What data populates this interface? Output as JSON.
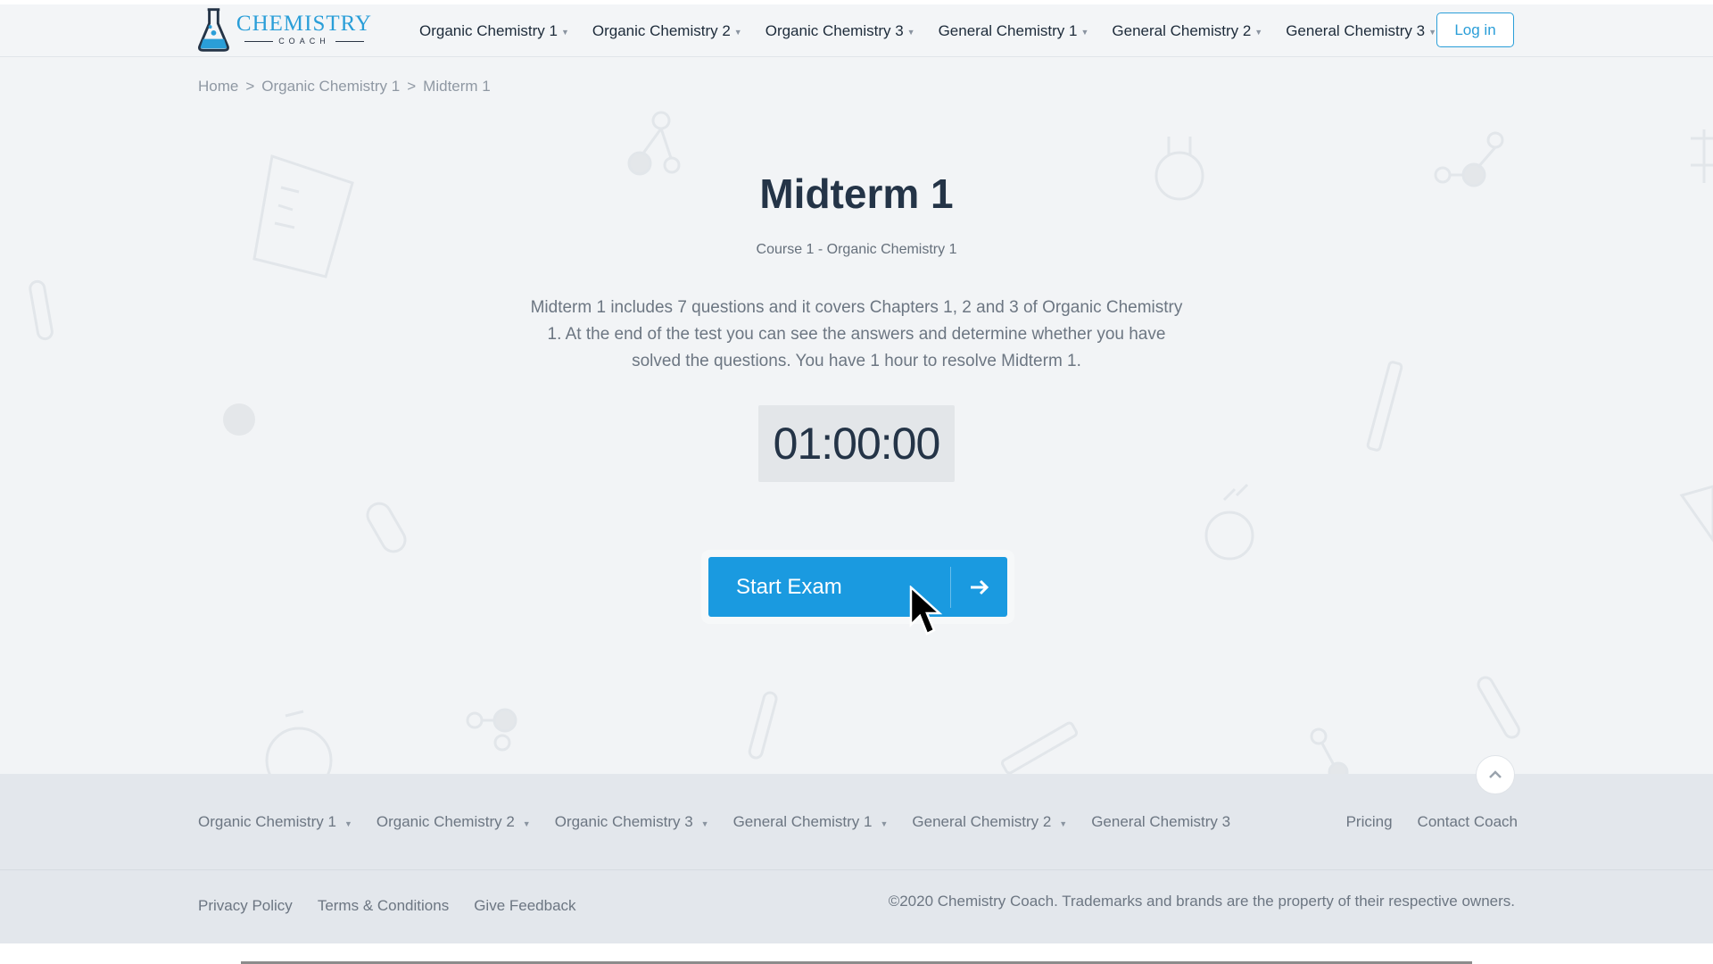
{
  "brand": {
    "name": "CHEMISTRY",
    "tagline": "COACH",
    "colors": {
      "primary": "#1a9ae0",
      "text_dark": "#243447",
      "text_muted": "#6c7682"
    }
  },
  "header": {
    "nav": [
      {
        "label": "Organic Chemistry 1",
        "icon": "chevron-down-icon"
      },
      {
        "label": "Organic Chemistry 2",
        "icon": "chevron-down-icon"
      },
      {
        "label": "Organic Chemistry 3",
        "icon": "chevron-down-icon"
      },
      {
        "label": "General Chemistry 1",
        "icon": "chevron-down-icon"
      },
      {
        "label": "General Chemistry 2",
        "icon": "chevron-down-icon"
      },
      {
        "label": "General Chemistry 3",
        "icon": "chevron-down-icon"
      }
    ],
    "login_label": "Log in"
  },
  "breadcrumb": {
    "items": [
      "Home",
      "Organic Chemistry 1",
      "Midterm 1"
    ],
    "separator": ">"
  },
  "exam": {
    "title": "Midterm 1",
    "course": "Course 1 - Organic Chemistry 1",
    "description": "Midterm 1 includes 7 questions and it covers Chapters 1, 2 and 3 of Organic Chemistry 1. At the end of the test you can see the answers and determine whether you have solved the questions. You have 1 hour to resolve Midterm 1.",
    "timer": "01:00:00",
    "start_label": "Start Exam",
    "start_icon": "arrow-right-icon"
  },
  "footer": {
    "nav": [
      {
        "label": "Organic Chemistry 1",
        "has_caret": true
      },
      {
        "label": "Organic Chemistry 2",
        "has_caret": true
      },
      {
        "label": "Organic Chemistry 3",
        "has_caret": true
      },
      {
        "label": "General Chemistry 1",
        "has_caret": true
      },
      {
        "label": "General Chemistry 2",
        "has_caret": true
      },
      {
        "label": "General Chemistry 3",
        "has_caret": false
      }
    ],
    "links_right": [
      "Pricing",
      "Contact Coach"
    ],
    "legal": [
      "Privacy Policy",
      "Terms & Conditions",
      "Give Feedback"
    ],
    "copyright": "©2020 Chemistry Coach. Trademarks and brands are the property of their respective owners.",
    "back_to_top_icon": "chevron-up-icon"
  }
}
